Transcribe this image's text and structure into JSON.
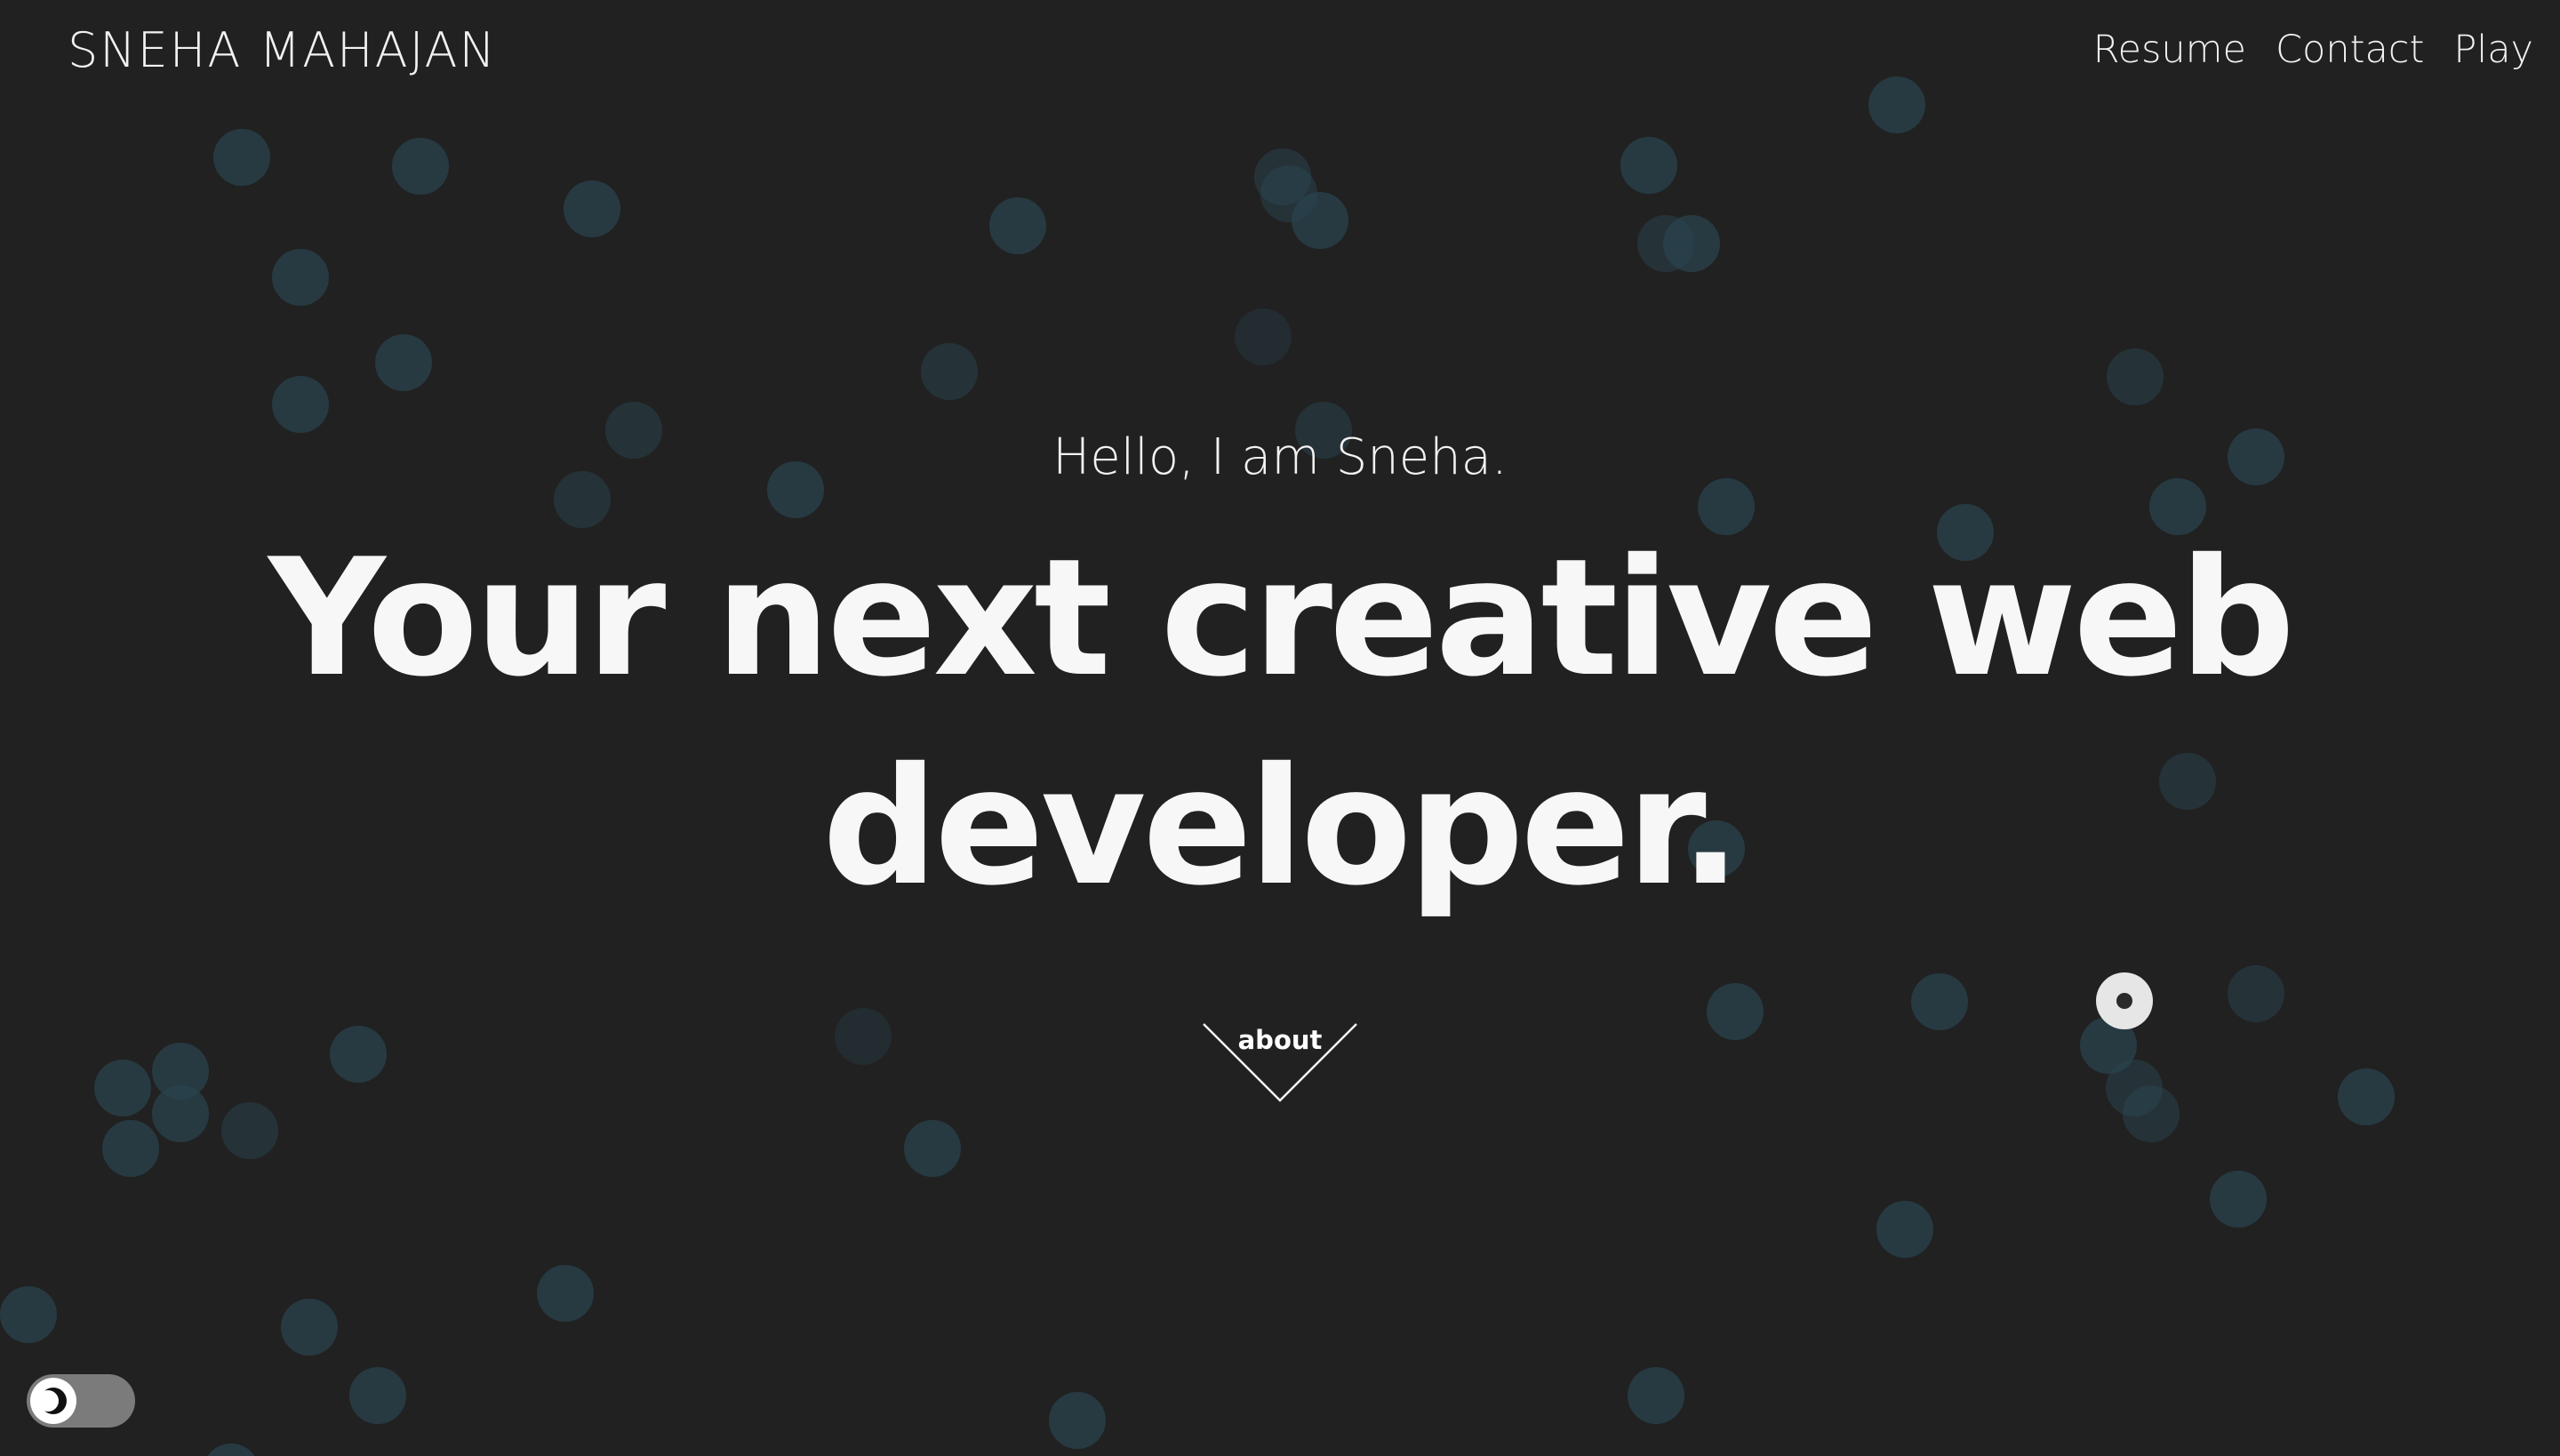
{
  "header": {
    "brand": "SNEHA MAHAJAN",
    "nav": [
      {
        "label": "Resume"
      },
      {
        "label": "Contact"
      },
      {
        "label": "Play"
      }
    ]
  },
  "hero": {
    "greeting": "Hello, I am Sneha.",
    "headline_line1": "Your next creative web",
    "headline_line2": "developer."
  },
  "about_link": {
    "label": "about",
    "icon": "chevron-down-icon"
  },
  "theme_toggle": {
    "icon": "moon-icon",
    "state": "dark"
  },
  "colors": {
    "background": "#212121",
    "text": "#f7f7f7",
    "bubble": "#29434e",
    "toggle_track": "#7b7b7b"
  }
}
